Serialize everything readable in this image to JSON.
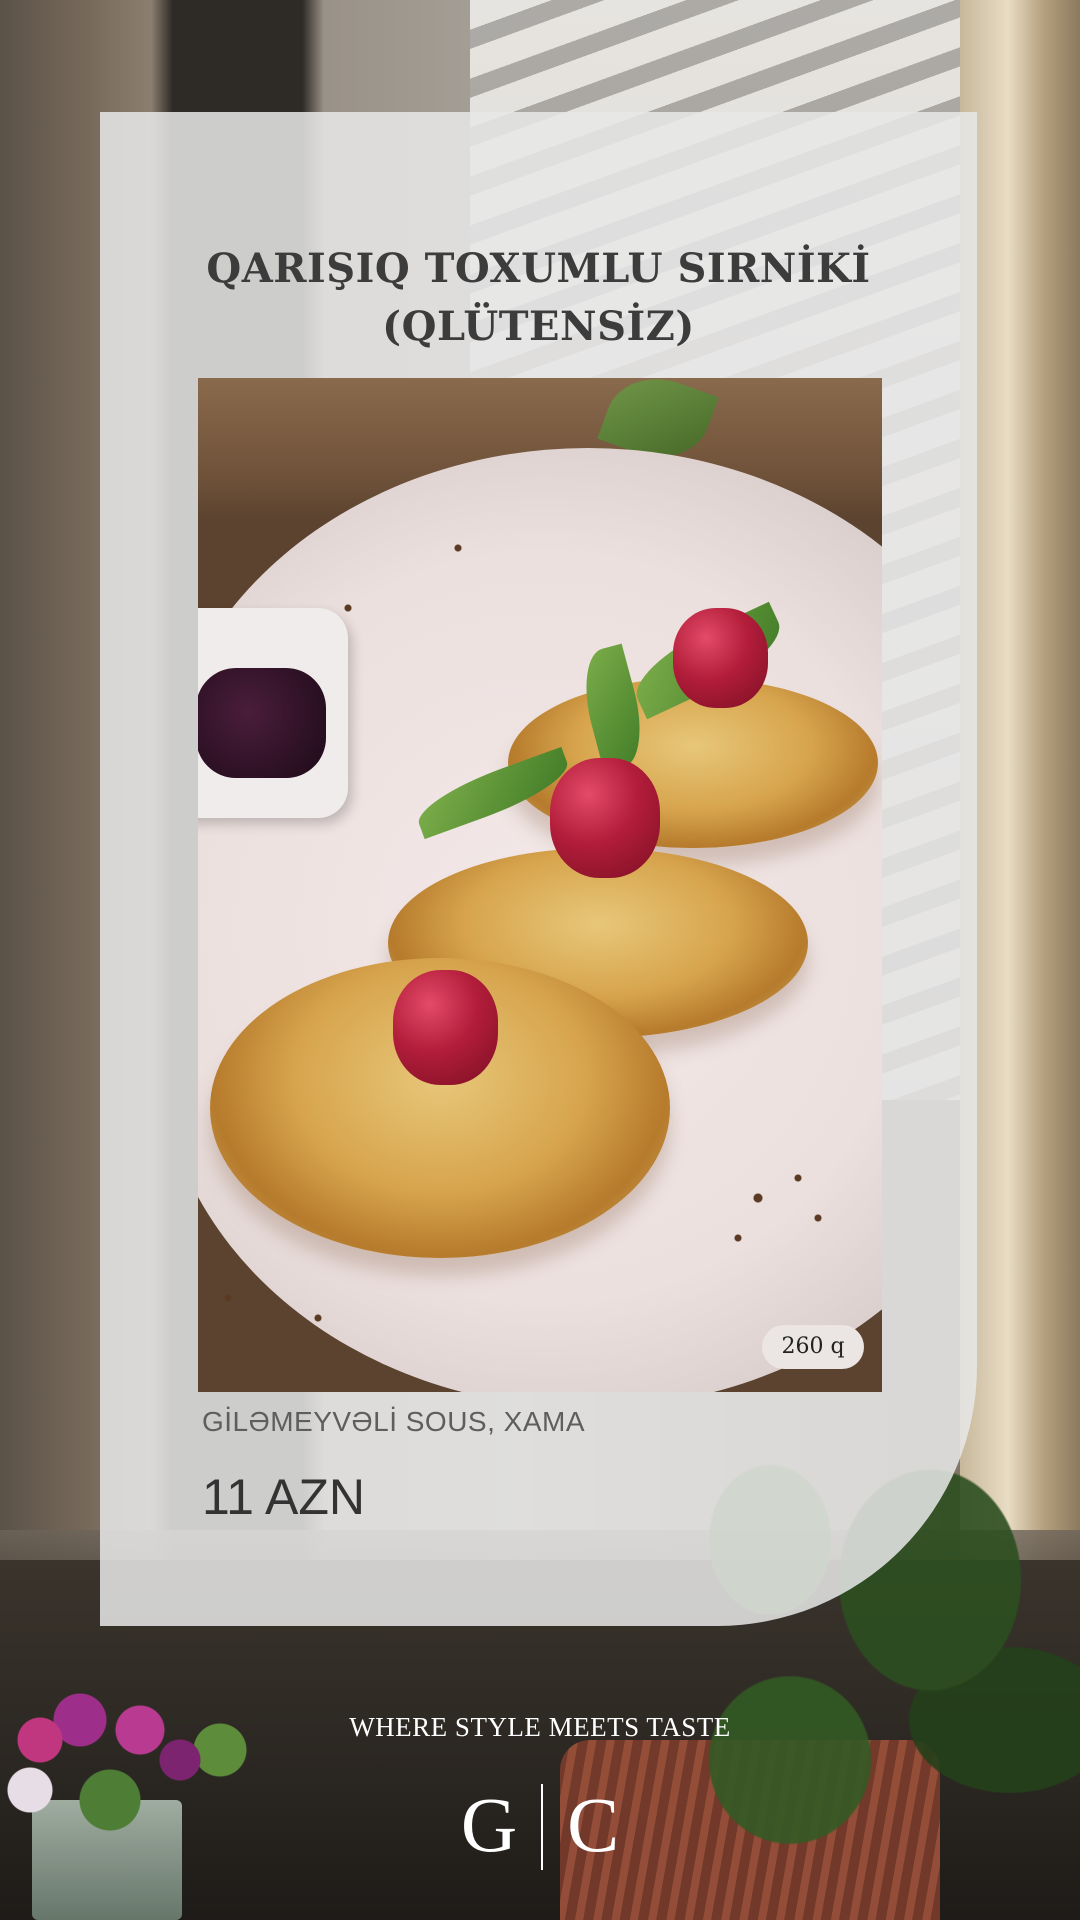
{
  "menu_item": {
    "title_line1": "QARIŞIQ TOXUMLU SIRNİKİ",
    "title_line2": "(QLÜTENSİZ)",
    "weight": "260 q",
    "ingredients": "GİLƏMEYVƏLİ SOUS, XAMA",
    "price": "11 AZN"
  },
  "brand": {
    "tagline": "WHERE STYLE MEETS TASTE",
    "logo_left": "G",
    "logo_right": "C"
  },
  "colors": {
    "card_background": "#e8e8e8",
    "title_text": "#3c3c3c",
    "price_text": "#333333",
    "ingredients_text": "#5e5e5e",
    "footer_text": "#ffffff"
  }
}
